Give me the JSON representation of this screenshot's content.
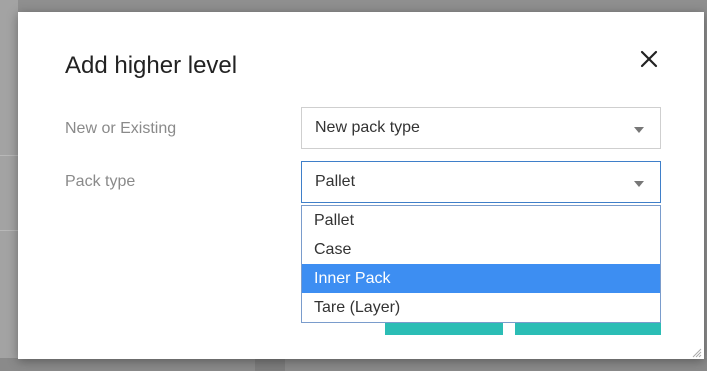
{
  "dialog": {
    "title": "Add higher level",
    "close_icon": "close-icon",
    "resize_icon": "resize-grip-icon"
  },
  "fields": {
    "new_or_existing": {
      "label": "New or Existing",
      "value": "New pack type"
    },
    "pack_type": {
      "label": "Pack type",
      "value": "Pallet",
      "options": [
        "Pallet",
        "Case",
        "Inner Pack",
        "Tare (Layer)"
      ],
      "highlighted_option": "Inner Pack"
    }
  },
  "colors": {
    "accent": "#2bbdb5",
    "highlight": "#3d8ef2",
    "focus_border": "#3f7fc9"
  }
}
